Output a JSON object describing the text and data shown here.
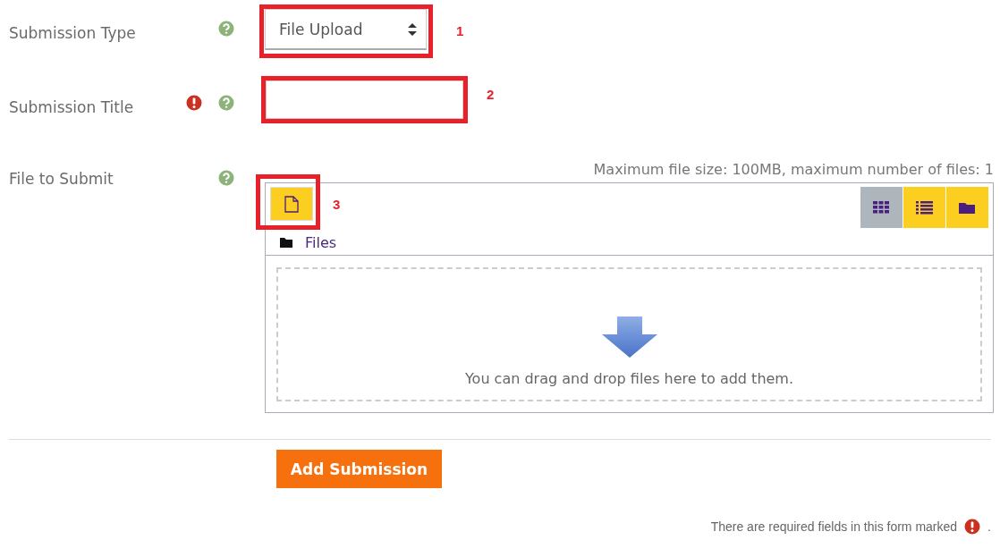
{
  "fields": [
    {
      "label": "Submission Type",
      "required": false,
      "kind": "select",
      "value": "File Upload",
      "annotation": "1"
    },
    {
      "label": "Submission Title",
      "required": true,
      "kind": "text",
      "annotation": "2"
    },
    {
      "label": "File to Submit",
      "required": false,
      "kind": "filemanager",
      "annotation": "3"
    }
  ],
  "filemanager": {
    "limits": "Maximum file size: 100MB, maximum number of files: 1",
    "path": "Files",
    "drop_hint": "You can drag and drop files here to add them.",
    "views": [
      {
        "kind": "icons",
        "selected": true
      },
      {
        "kind": "list",
        "selected": false
      },
      {
        "kind": "tree",
        "selected": false
      }
    ]
  },
  "submit_button": "Add Submission",
  "footer": {
    "text": "There are required fields in this form marked",
    "end": "."
  }
}
